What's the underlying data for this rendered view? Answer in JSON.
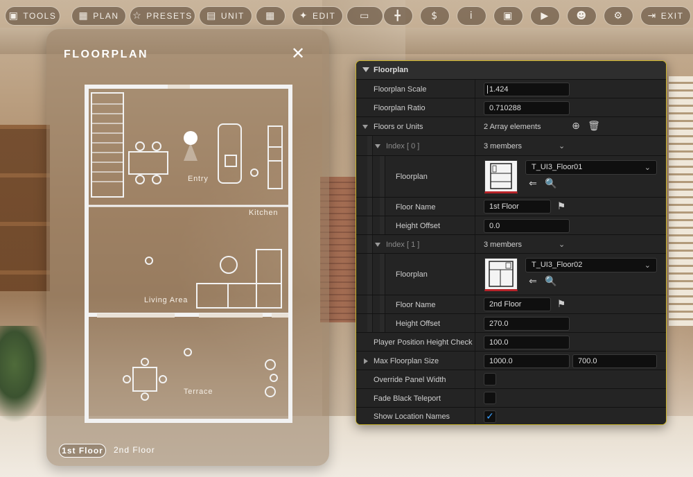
{
  "toolbar": {
    "items": [
      {
        "name": "tools",
        "label": "TOOLS",
        "icon": "camera-icon"
      },
      {
        "name": "plan",
        "label": "PLAN",
        "icon": "map-icon"
      },
      {
        "name": "presets",
        "label": "PRESETS",
        "icon": "star-icon"
      },
      {
        "name": "unit",
        "label": "UNIT",
        "icon": "building-icon"
      },
      {
        "name": "floorplan",
        "label": "",
        "icon": "floorplan-icon"
      },
      {
        "name": "edit",
        "label": "EDIT",
        "icon": "palette-icon"
      },
      {
        "name": "furniture",
        "label": "",
        "icon": "sofa-icon"
      },
      {
        "name": "measure",
        "label": "",
        "icon": "measure-icon"
      },
      {
        "name": "price",
        "label": "",
        "icon": "dollar-icon"
      },
      {
        "name": "info",
        "label": "",
        "icon": "info-icon"
      },
      {
        "name": "gallery",
        "label": "",
        "icon": "image-icon"
      },
      {
        "name": "play",
        "label": "",
        "icon": "play-icon"
      },
      {
        "name": "profile",
        "label": "",
        "icon": "user-icon"
      },
      {
        "name": "settings",
        "label": "",
        "icon": "gear-icon"
      },
      {
        "name": "exit",
        "label": "EXIT",
        "icon": "exit-icon"
      }
    ]
  },
  "floorplan_panel": {
    "title": "FLOORPLAN",
    "rooms": {
      "entry": "Entry",
      "kitchen": "Kitchen",
      "living": "Living Area",
      "terrace": "Terrace"
    },
    "floor_tabs": {
      "active": "1st Floor",
      "inactive": "2nd Floor"
    }
  },
  "details": {
    "category": "Floorplan",
    "floorplan_scale": {
      "label": "Floorplan Scale",
      "value": "1.424"
    },
    "floorplan_ratio": {
      "label": "Floorplan Ratio",
      "value": "0.710288"
    },
    "floors_or_units": {
      "label": "Floors or Units",
      "value": "2 Array elements"
    },
    "index0": {
      "label": "Index [ 0 ]",
      "members": "3 members",
      "floorplan_label": "Floorplan",
      "floorplan_asset": "T_UI3_Floor01",
      "floor_name_label": "Floor Name",
      "floor_name": "1st Floor",
      "height_offset_label": "Height Offset",
      "height_offset": "0.0"
    },
    "index1": {
      "label": "Index [ 1 ]",
      "members": "3 members",
      "floorplan_label": "Floorplan",
      "floorplan_asset": "T_UI3_Floor02",
      "floor_name_label": "Floor Name",
      "floor_name": "2nd Floor",
      "height_offset_label": "Height Offset",
      "height_offset": "270.0"
    },
    "player_height_check": {
      "label": "Player Position Height Check",
      "value": "100.0"
    },
    "max_floorplan_size": {
      "label": "Max Floorplan Size",
      "x": "1000.0",
      "y": "700.0"
    },
    "override_panel_width": {
      "label": "Override Panel Width",
      "checked": false
    },
    "fade_black_teleport": {
      "label": "Fade Black Teleport",
      "checked": false
    },
    "show_location_names": {
      "label": "Show Location Names",
      "checked": true
    }
  },
  "colors": {
    "panel_border": "#c9b32a",
    "checkbox_check": "#3aa0ff",
    "thumbnail_underline": "#b8242a"
  }
}
